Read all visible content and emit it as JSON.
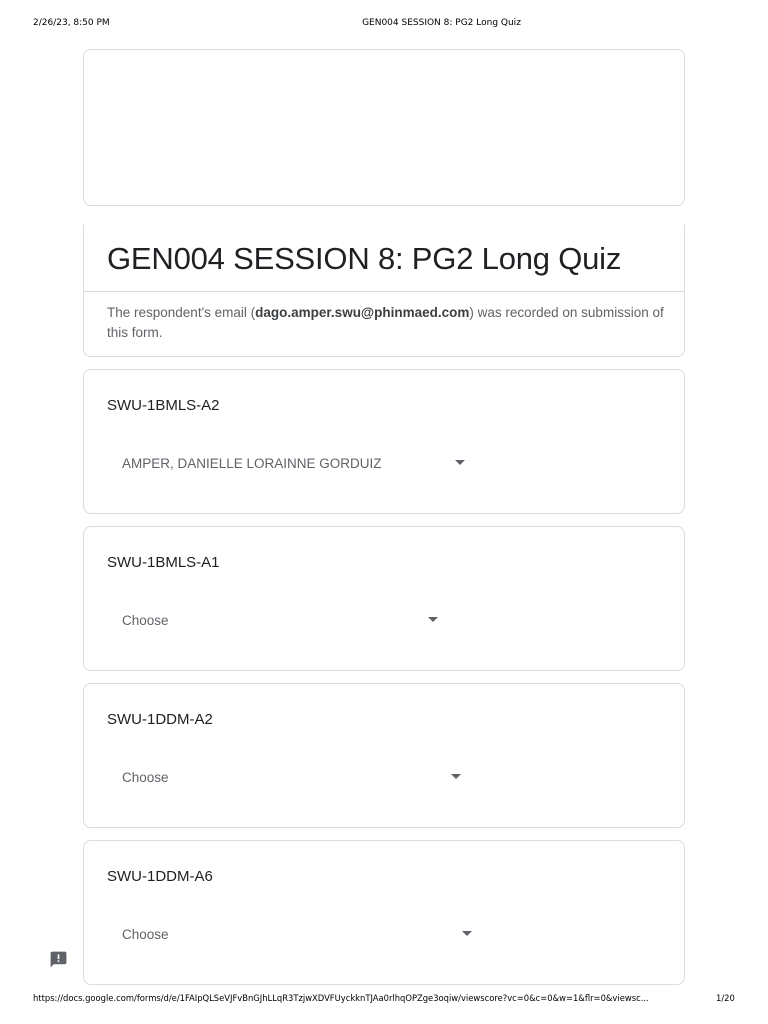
{
  "print": {
    "date": "2/26/23, 8:50 PM",
    "title": "GEN004 SESSION 8: PG2 Long Quiz",
    "url": "https://docs.google.com/forms/d/e/1FAIpQLSeVJFvBnGJhLLqR3TzjwXDVFUyckknTJAa0rlhqOPZge3oqiw/viewscore?vc=0&c=0&w=1&flr=0&viewsc...",
    "page": "1/20"
  },
  "form": {
    "title": "GEN004 SESSION 8: PG2 Long Quiz",
    "email_prefix": "The respondent's email (",
    "email": "dago.amper.swu@phinmaed.com",
    "email_suffix": ") was recorded on submission of this form."
  },
  "questions": [
    {
      "label": "SWU-1BMLS-A2",
      "value": "AMPER, DANIELLE LORAINNE GORDUIZ"
    },
    {
      "label": "SWU-1BMLS-A1",
      "value": "Choose"
    },
    {
      "label": "SWU-1DDM-A2",
      "value": "Choose"
    },
    {
      "label": "SWU-1DDM-A6",
      "value": "Choose"
    }
  ],
  "icons": {
    "feedback": "feedback-icon"
  },
  "colors": {
    "border": "#dadce0",
    "text": "#202124",
    "muted": "#5f6368"
  }
}
